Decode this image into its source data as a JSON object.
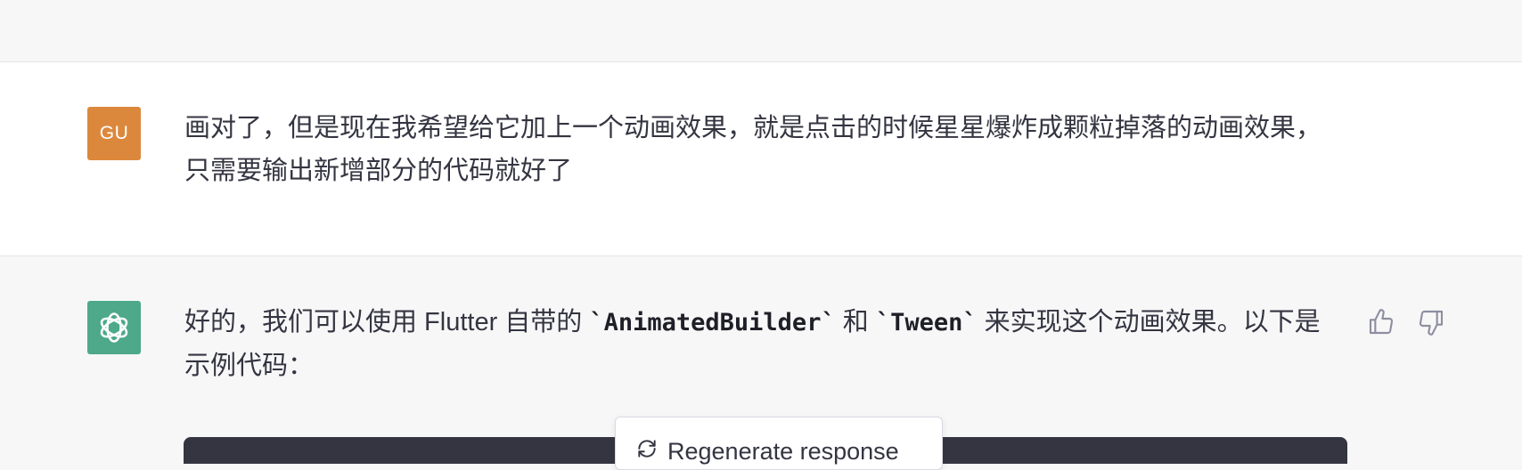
{
  "user_message": {
    "avatar_initials": "GU",
    "avatar_color": "#dc883c",
    "text": "画对了，但是现在我希望给它加上一个动画效果，就是点击的时候星星爆炸成颗粒掉落的动画效果，只需要输出新增部分的代码就好了"
  },
  "assistant_message": {
    "avatar_icon": "openai-logo-icon",
    "avatar_color": "#4da98a",
    "text_part1": "好的，我们可以使用 Flutter 自带的 ",
    "code1": "`AnimatedBuilder`",
    "text_part2": " 和 ",
    "code2": "`Tween`",
    "text_part3": " 来实现这个动画效果。以下是示例代码：",
    "actions": {
      "thumbs_up_icon": "thumbs-up-icon",
      "thumbs_down_icon": "thumbs-down-icon"
    }
  },
  "popup": {
    "icon": "regenerate-icon",
    "label": "Regenerate response"
  }
}
